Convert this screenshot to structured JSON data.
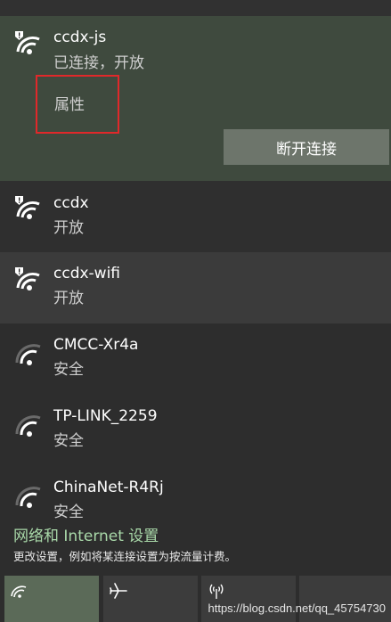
{
  "networks": [
    {
      "name": "ccdx-js",
      "status": "已连接，开放",
      "secured": false,
      "connected": true,
      "properties_label": "属性",
      "disconnect_label": "断开连接"
    },
    {
      "name": "ccdx",
      "status": "开放",
      "secured": false
    },
    {
      "name": "ccdx-wifi",
      "status": "开放",
      "secured": false
    },
    {
      "name": "CMCC-Xr4a",
      "status": "安全",
      "secured": true
    },
    {
      "name": "TP-LINK_2259",
      "status": "安全",
      "secured": true
    },
    {
      "name": "ChinaNet-R4Rj",
      "status": "安全",
      "secured": true
    }
  ],
  "settings": {
    "link": "网络和 Internet 设置",
    "description": "更改设置，例如将某连接设置为按流量计费。"
  },
  "quick_actions": [
    {
      "icon": "wifi-icon",
      "active": true
    },
    {
      "icon": "airplane-icon",
      "active": false
    },
    {
      "icon": "mobile-hotspot-icon",
      "active": false
    }
  ],
  "watermark": "https://blog.csdn.net/qq_45754730",
  "colors": {
    "selected_bg": "#3f4a3e",
    "accent_link": "#a9d9a9",
    "highlight_box": "#e0282a"
  }
}
